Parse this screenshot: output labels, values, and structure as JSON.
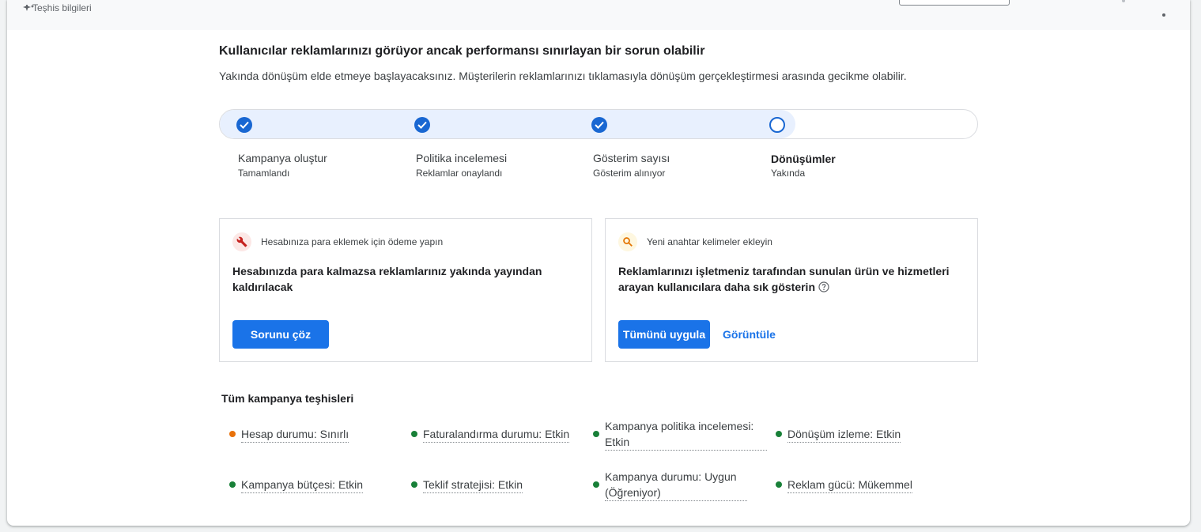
{
  "topbar": {
    "label": "Teşhis bilgileri",
    "sparkle_icon": "sparkle-icon",
    "more_icon": "more-vert-icon"
  },
  "status": {
    "headline": "Kullanıcılar reklamlarınızı görüyor ancak performansı sınırlayan bir sorun olabilir",
    "description": "Yakında dönüşüm elde etmeye başlayacaksınız. Müşterilerin reklamlarınızı tıklamasıyla dönüşüm gerçekleştirmesi arasında gecikme olabilir."
  },
  "progress": {
    "completed_fraction": 0.76,
    "steps": [
      {
        "title": "Kampanya oluştur",
        "subtitle": "Tamamlandı",
        "state": "done"
      },
      {
        "title": "Politika incelemesi",
        "subtitle": "Reklamlar onaylandı",
        "state": "done"
      },
      {
        "title": "Gösterim sayısı",
        "subtitle": "Gösterim alınıyor",
        "state": "done"
      },
      {
        "title": "Dönüşümler",
        "subtitle": "Yakında",
        "state": "current"
      }
    ]
  },
  "recommendations": [
    {
      "icon": "wrench-icon",
      "icon_color": "#c5221f",
      "icon_bg": "#fce8e6",
      "label": "Hesabınıza para eklemek için ödeme yapın",
      "text": "Hesabınızda para kalmazsa reklamlarınız yakında yayından kaldırılacak",
      "primary_button": "Sorunu çöz"
    },
    {
      "icon": "search-icon",
      "icon_color": "#e37400",
      "icon_bg": "#fef7e0",
      "label": "Yeni anahtar kelimeler ekleyin",
      "text": "Reklamlarınızı işletmeniz tarafından sunulan ürün ve hizmetleri arayan kullanıcılara daha sık gösterin",
      "primary_button": "Tümünü uygula",
      "secondary_button": "Görüntüle"
    }
  ],
  "diagnostics": {
    "title": "Tüm kampanya teşhisleri",
    "items": [
      {
        "text": "Hesap durumu: Sınırlı",
        "status_color": "#e8710a"
      },
      {
        "text": "Faturalandırma durumu: Etkin",
        "status_color": "#188038"
      },
      {
        "text": "Kampanya politika incelemesi: Etkin",
        "status_color": "#188038"
      },
      {
        "text": "Dönüşüm izleme: Etkin",
        "status_color": "#188038"
      },
      {
        "text": "Kampanya bütçesi: Etkin",
        "status_color": "#188038"
      },
      {
        "text": "Teklif stratejisi: Etkin",
        "status_color": "#188038"
      },
      {
        "text": "Kampanya durumu: Uygun (Öğreniyor)",
        "status_color": "#188038"
      },
      {
        "text": "Reklam gücü: Mükemmel",
        "status_color": "#188038"
      }
    ]
  },
  "colors": {
    "accent": "#1a73e8",
    "progress_fill": "#e8f0fe",
    "check": "#1967d2"
  }
}
